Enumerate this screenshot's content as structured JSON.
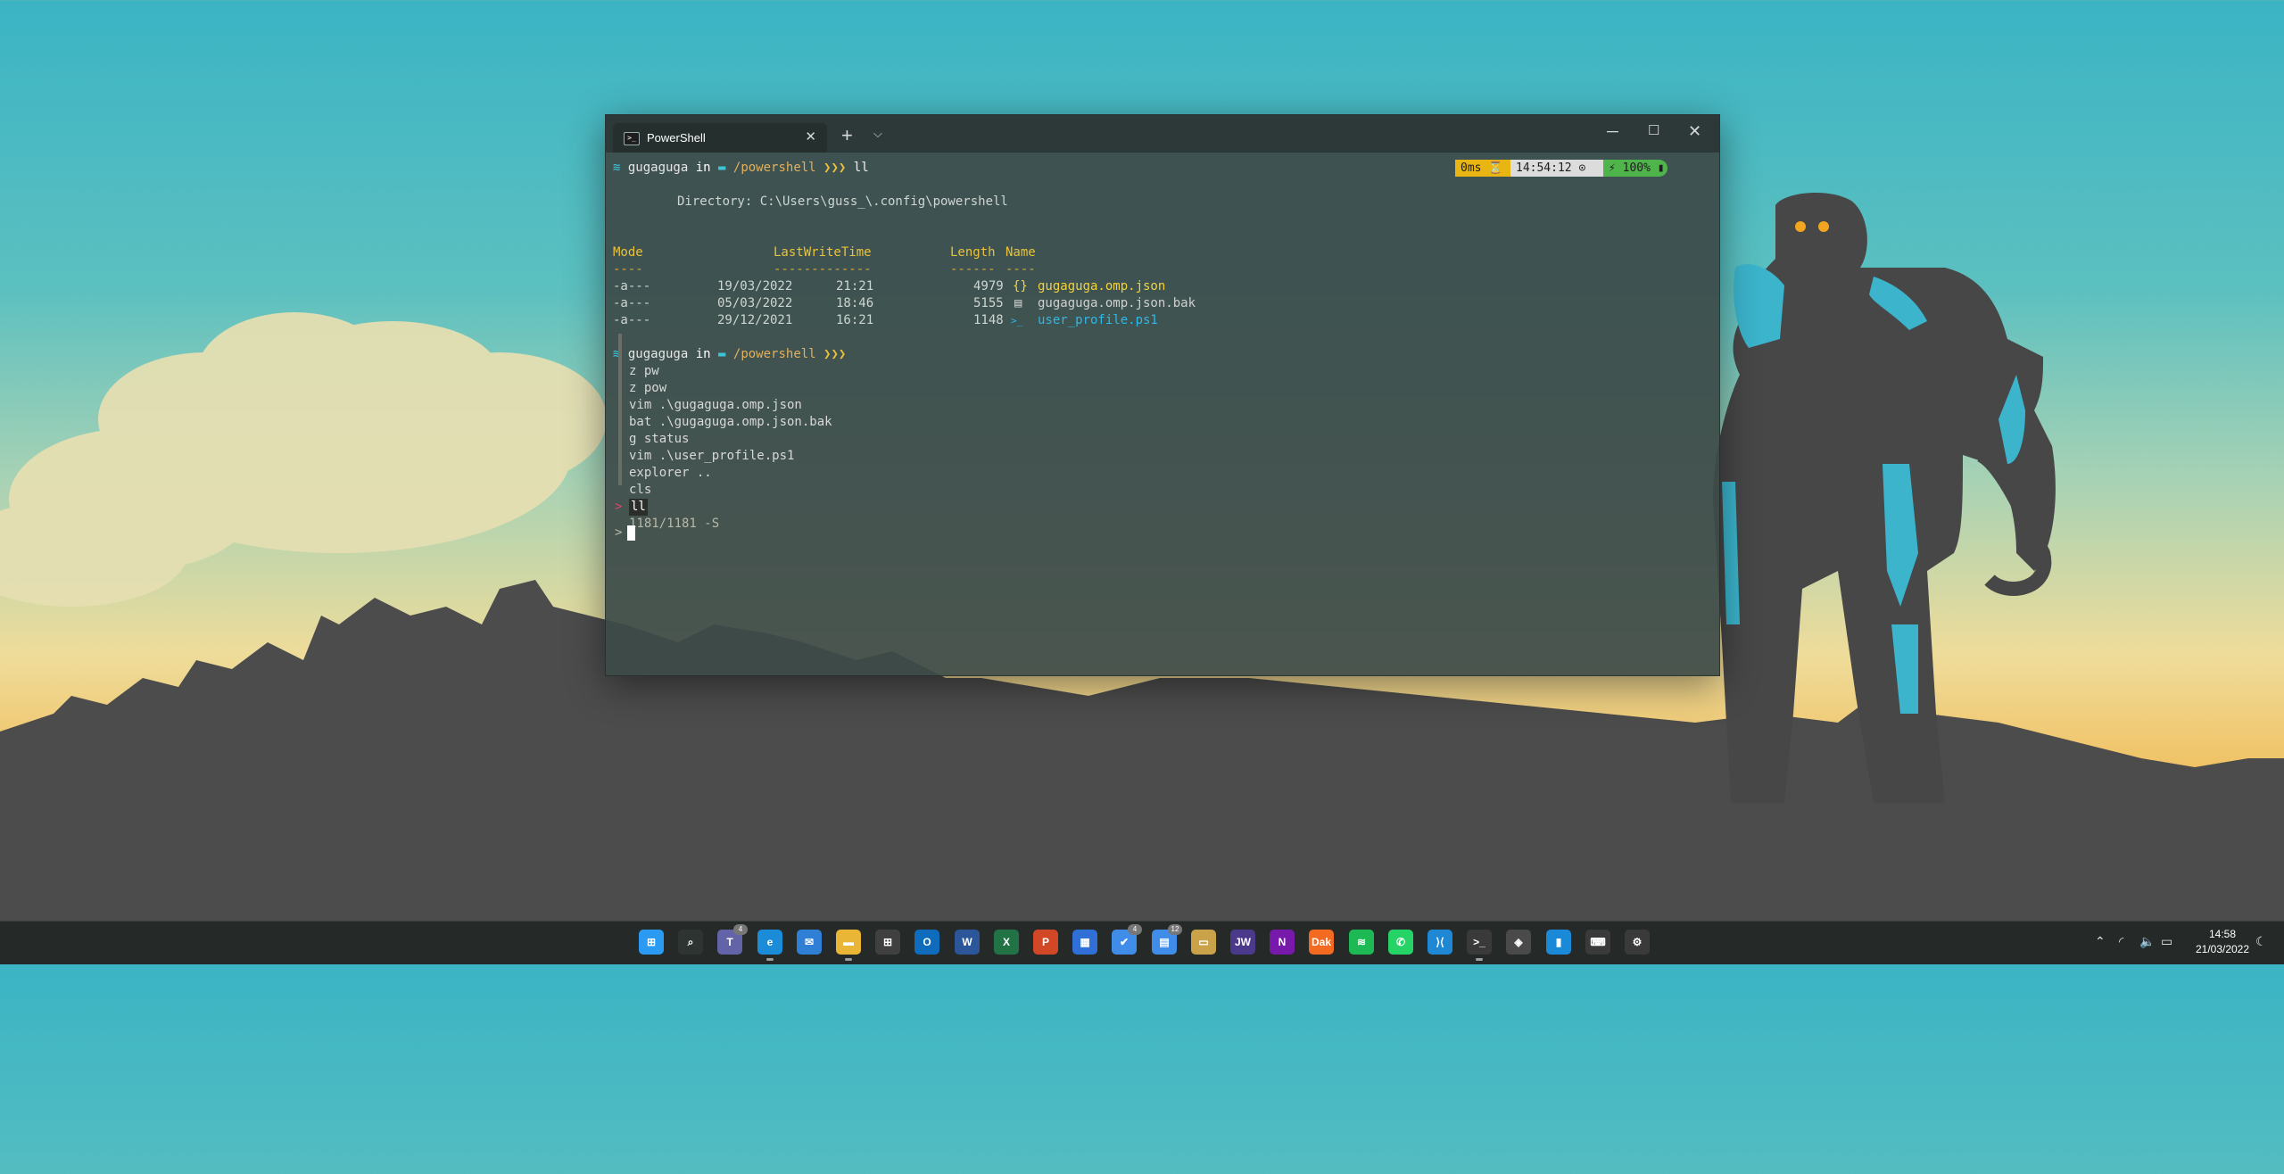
{
  "window": {
    "tab_title": "PowerShell",
    "tab_icon": "powershell-icon",
    "tab_close_glyph": "✕",
    "new_tab_glyph": "+",
    "tab_menu_glyph": "⌵",
    "minimize_glyph": "─",
    "maximize_glyph": "☐",
    "close_glyph": "✕"
  },
  "terminal": {
    "prompt1": {
      "user": "gugaguga",
      "in_word": "in",
      "path": "/powershell",
      "arrows": "❯❯❯",
      "command": "ll"
    },
    "status": {
      "exec_time": "0ms ⏳",
      "clock": "14:54:12 ⊙",
      "battery": "⚡ 100% ▮"
    },
    "directory_line": "Directory: C:\\Users\\guss_\\.config\\powershell",
    "headers": {
      "mode": "Mode",
      "lastwrite": "LastWriteTime",
      "length": "Length",
      "name": "Name"
    },
    "dashes": {
      "mode": "----",
      "lastwrite": "-------------",
      "length": "------",
      "name": "----"
    },
    "files": [
      {
        "mode": "-a---",
        "date": "19/03/2022",
        "time": "21:21",
        "length": "4979",
        "icon": "{}",
        "name": "gugaguga.omp.json"
      },
      {
        "mode": "-a---",
        "date": "05/03/2022",
        "time": "18:46",
        "length": "5155",
        "icon": "▤",
        "name": "gugaguga.omp.json.bak"
      },
      {
        "mode": "-a---",
        "date": "29/12/2021",
        "time": "16:21",
        "length": "1148",
        "icon": ">_",
        "name": "user_profile.ps1"
      }
    ],
    "prompt2": {
      "user": "gugaguga",
      "in_word": "in",
      "path": "/powershell",
      "arrows": "❯❯❯"
    },
    "history": [
      "z pw",
      "z pow",
      "vim .\\gugaguga.omp.json",
      "bat .\\gugaguga.omp.json.bak",
      "g status",
      "vim .\\user_profile.ps1",
      "explorer ..",
      "cls"
    ],
    "history_selected_marker": ">",
    "history_selected": "ll",
    "history_count": "1181/1181 -S",
    "input_prompt": ">"
  },
  "taskbar": {
    "icons": [
      {
        "name": "start-icon",
        "label": "⊞",
        "color": "#2b9af3"
      },
      {
        "name": "search-icon",
        "label": "⌕",
        "color": "#2e3431"
      },
      {
        "name": "teams-icon",
        "label": "T",
        "color": "#6264a7",
        "badge": "4"
      },
      {
        "name": "edge-icon",
        "label": "e",
        "color": "#1a8cd8",
        "running": true
      },
      {
        "name": "mail-icon",
        "label": "✉",
        "color": "#2f7fd6"
      },
      {
        "name": "file-explorer-icon",
        "label": "▬",
        "color": "#e9b635",
        "running": true
      },
      {
        "name": "store-icon",
        "label": "⊞",
        "color": "#404040"
      },
      {
        "name": "outlook-icon",
        "label": "O",
        "color": "#0f6cbd"
      },
      {
        "name": "word-icon",
        "label": "W",
        "color": "#2b579a"
      },
      {
        "name": "excel-icon",
        "label": "X",
        "color": "#217346"
      },
      {
        "name": "powerpoint-icon",
        "label": "P",
        "color": "#d24726"
      },
      {
        "name": "calendar-icon",
        "label": "▦",
        "color": "#2f6fd6"
      },
      {
        "name": "todo-icon",
        "label": "✔",
        "color": "#3f8de8",
        "badge": "4"
      },
      {
        "name": "notes-icon",
        "label": "▤",
        "color": "#3f8de8",
        "badge": "12"
      },
      {
        "name": "folder-icon",
        "label": "▭",
        "color": "#c9a24a"
      },
      {
        "name": "jw-icon",
        "label": "JW",
        "color": "#4b3a8c"
      },
      {
        "name": "onenote-icon",
        "label": "N",
        "color": "#7719aa"
      },
      {
        "name": "dak-icon",
        "label": "Dak",
        "color": "#f26b21"
      },
      {
        "name": "spotify-icon",
        "label": "≋",
        "color": "#1db954"
      },
      {
        "name": "whatsapp-icon",
        "label": "✆",
        "color": "#25d366"
      },
      {
        "name": "vscode-icon",
        "label": "⟩⟨",
        "color": "#1e88d4"
      },
      {
        "name": "terminal-icon",
        "label": ">_",
        "color": "#3a3a3a",
        "running": true
      },
      {
        "name": "davinci-icon",
        "label": "◈",
        "color": "#4a4a4a"
      },
      {
        "name": "app-blue-icon",
        "label": "▮",
        "color": "#1a8ad8"
      },
      {
        "name": "gamepad-icon",
        "label": "⌨",
        "color": "#3a3a3a"
      },
      {
        "name": "settings-icon",
        "label": "⚙",
        "color": "#3a3a3a"
      }
    ],
    "tray": {
      "chevron": "⌃",
      "wifi": "◜",
      "volume": "🔈",
      "battery": "▭"
    },
    "time": "14:58",
    "date": "21/03/2022",
    "moon": "☾"
  }
}
